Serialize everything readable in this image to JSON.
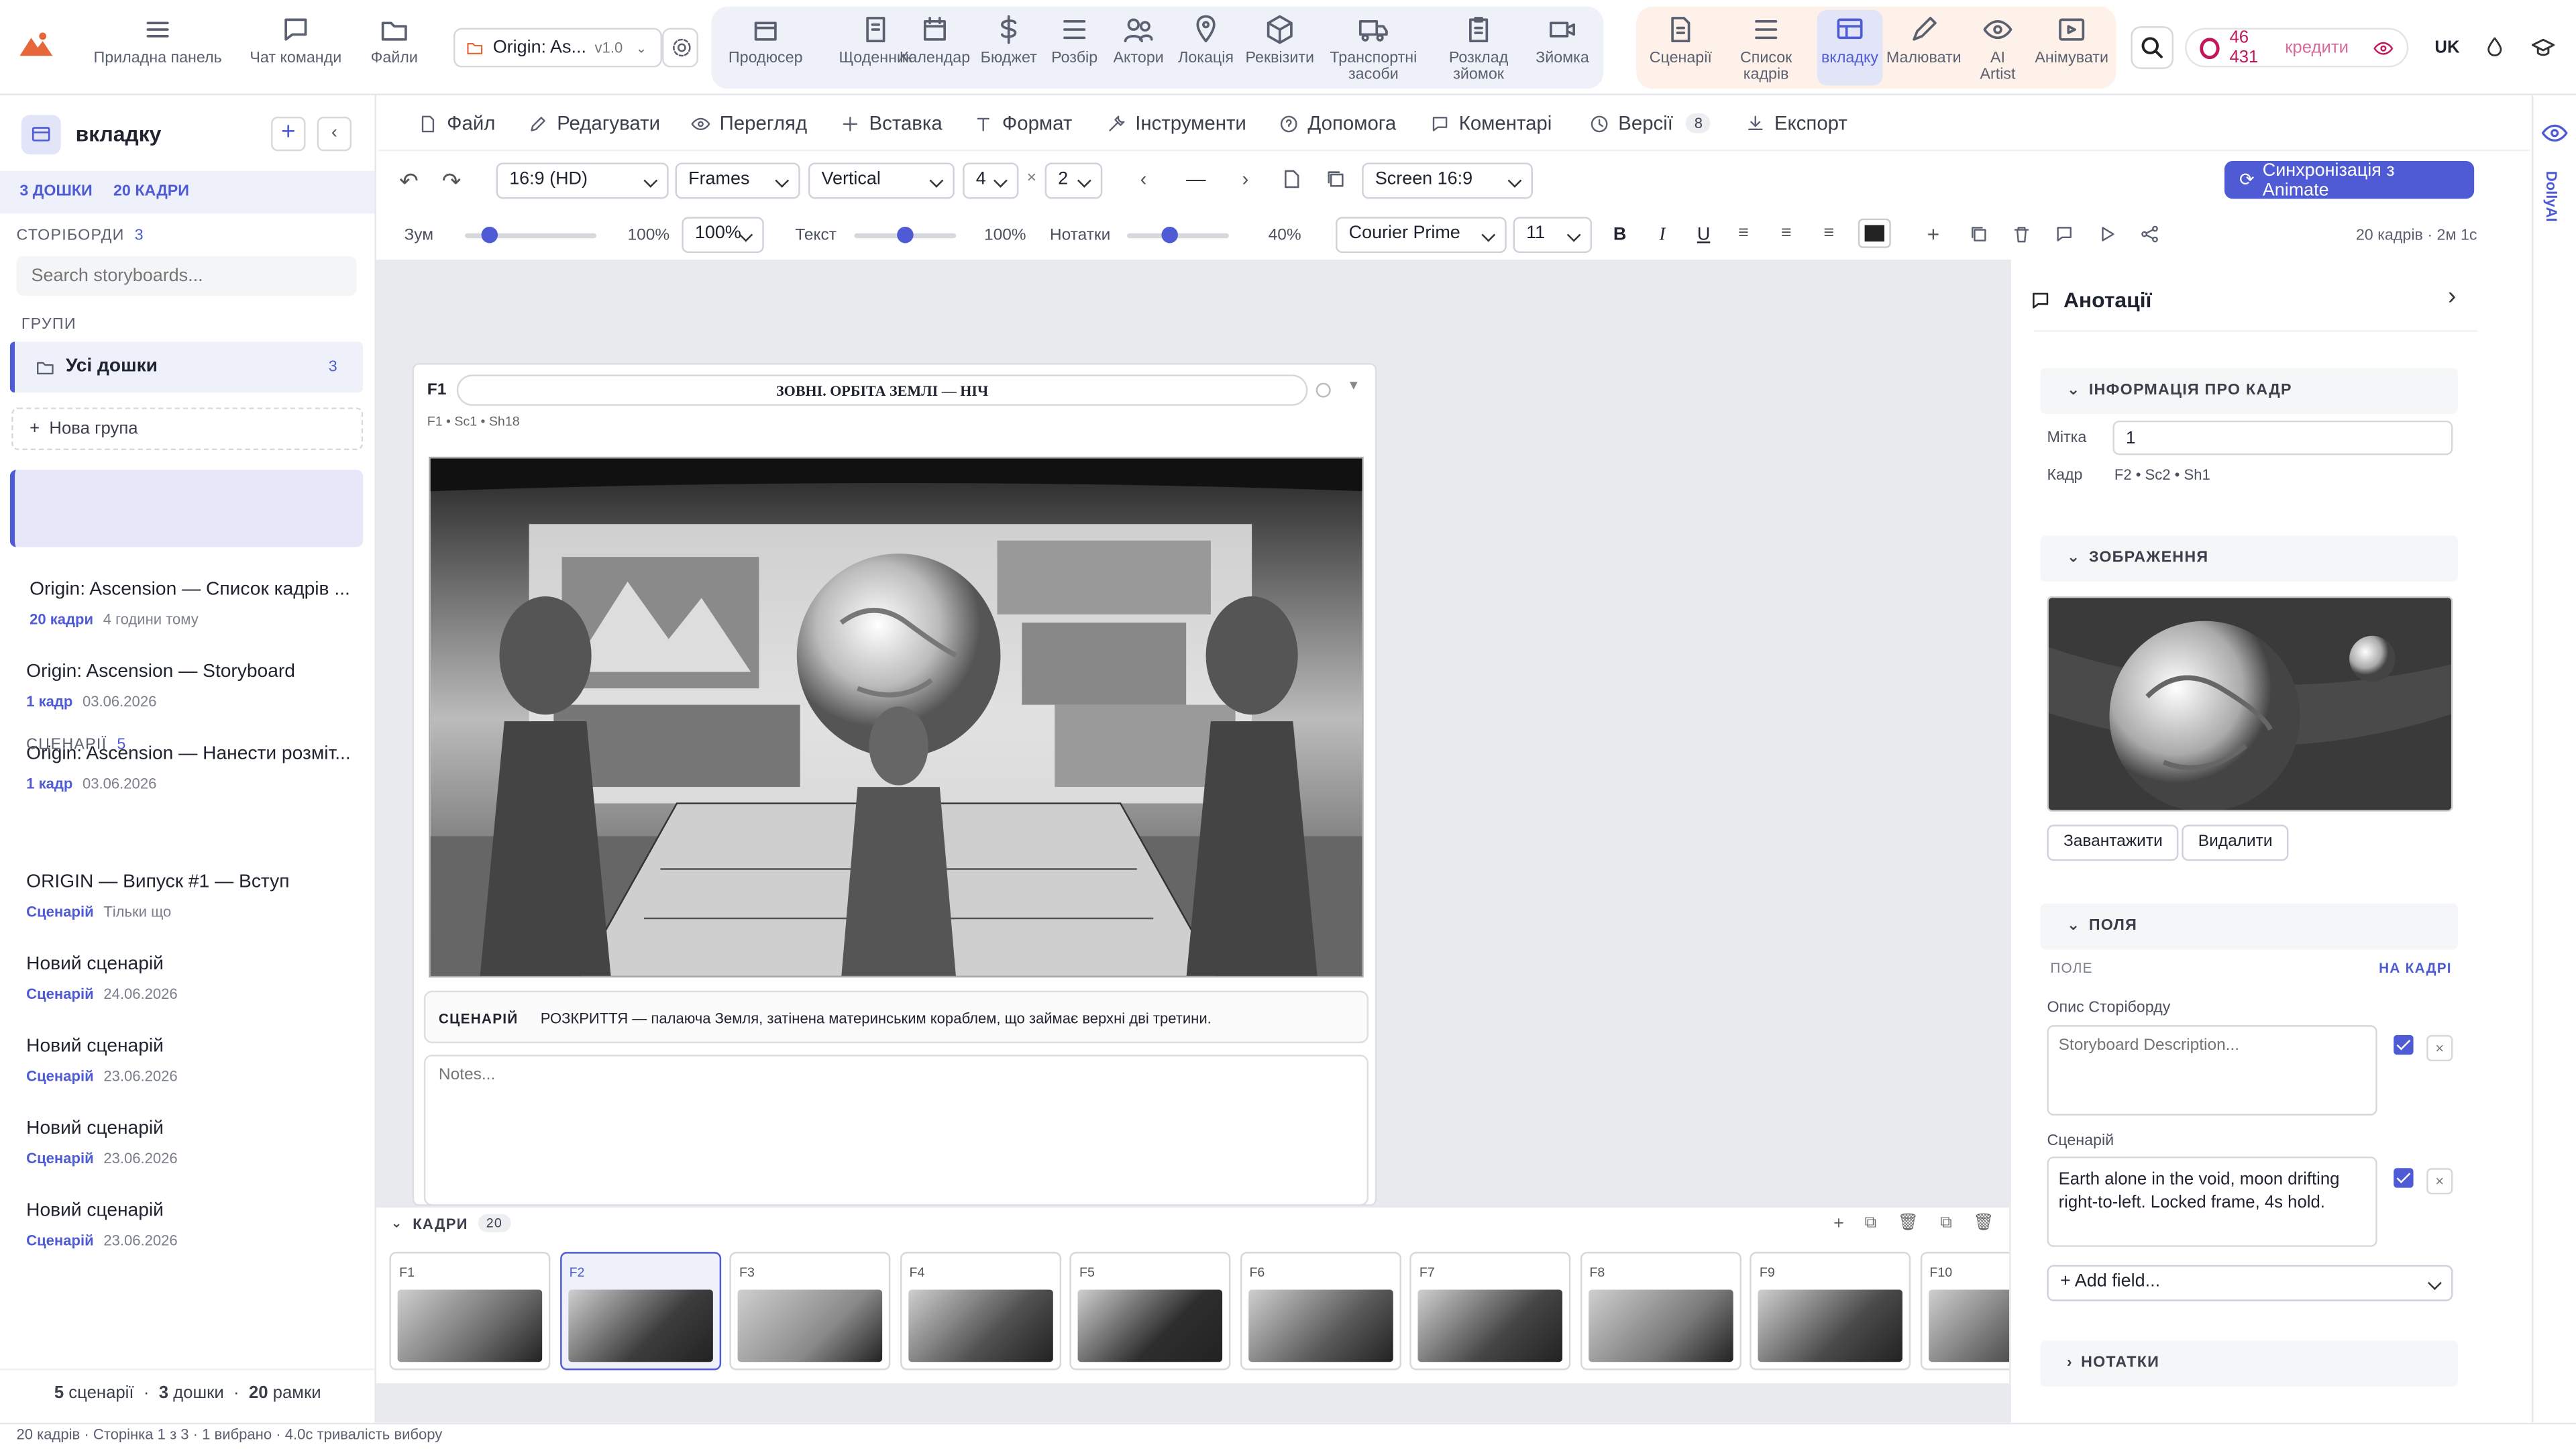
{
  "app": {
    "brand": "logo",
    "title": "вкладку"
  },
  "nav_left": [
    {
      "label": "Приладна панель",
      "icon": "dashboard-icon"
    },
    {
      "label": "Чат команди",
      "icon": "chat-icon"
    },
    {
      "label": "Файли",
      "icon": "folder-icon"
    }
  ],
  "project": {
    "name": "Origin: As...",
    "version": "v1.0"
  },
  "nav_mid": [
    {
      "label": "Продюсер",
      "icon": "producer-icon"
    },
    {
      "label": "Щоденник",
      "icon": "journal-icon"
    },
    {
      "label": "Календар",
      "icon": "calendar-icon"
    },
    {
      "label": "Бюджет",
      "icon": "dollar-icon"
    },
    {
      "label": "Розбір",
      "icon": "breakdown-icon"
    },
    {
      "label": "Актори",
      "icon": "actors-icon"
    },
    {
      "label": "Локація",
      "icon": "location-icon"
    },
    {
      "label": "Реквізити",
      "icon": "props-icon"
    },
    {
      "label": "Транспортні засоби",
      "icon": "vehicle-icon"
    },
    {
      "label": "Розклад зйомок",
      "icon": "schedule-icon"
    },
    {
      "label": "Зйомка",
      "icon": "camera-icon"
    }
  ],
  "nav_right": [
    {
      "label": "Сценарії",
      "icon": "script-icon"
    },
    {
      "label": "Список кадрів",
      "icon": "shotlist-icon"
    },
    {
      "label": "вкладку",
      "icon": "storyboard-icon"
    },
    {
      "label": "Малювати",
      "icon": "pencil-icon"
    },
    {
      "label": "AI Artist",
      "icon": "eye-icon"
    },
    {
      "label": "Анімувати",
      "icon": "animate-icon"
    }
  ],
  "credits": {
    "amount": "46 431",
    "label": "кредити"
  },
  "lang": "UK",
  "menus": [
    {
      "label": "Файл",
      "icon": "file-icon"
    },
    {
      "label": "Редагувати",
      "icon": "edit-icon"
    },
    {
      "label": "Перегляд",
      "icon": "eye-icon"
    },
    {
      "label": "Вставка",
      "icon": "plus-icon"
    },
    {
      "label": "Формат",
      "icon": "text-icon"
    },
    {
      "label": "Інструменти",
      "icon": "tools-icon"
    },
    {
      "label": "Допомога",
      "icon": "help-icon"
    },
    {
      "label": "Коментарі",
      "icon": "comment-icon"
    },
    {
      "label": "Версії",
      "icon": "history-icon",
      "badge": "8"
    },
    {
      "label": "Експорт",
      "icon": "export-icon"
    }
  ],
  "toolbar": {
    "aspect": "16:9 (HD)",
    "frames": "Frames",
    "layout": "Vertical",
    "cols": "4",
    "rows": "2",
    "screen": "Screen 16:9",
    "sync": "Синхронізація з Animate"
  },
  "toolbar3": {
    "zoom_label": "Зум",
    "zoom_value": "100%",
    "zoom_select": "100%",
    "text_label": "Текст",
    "text_value": "100%",
    "notes_label": "Нотатки",
    "notes_value": "40%",
    "font": "Courier Prime",
    "size": "11",
    "bold": "B",
    "italic": "I",
    "underline": "U",
    "summary": "20 кадрів · 2м 1с"
  },
  "sidebar": {
    "title": "вкладку",
    "boards_tab": "3 ДОШКИ",
    "frames_tab": "20 КАДРИ",
    "storyboards_label": "СТОРІБОРДИ",
    "storyboards_count": "3",
    "search_placeholder": "Search storyboards...",
    "groups_label": "ГРУПИ",
    "all_boards": "Усі дошки",
    "all_count": "3",
    "new_group": "Нова група",
    "boards": [
      {
        "title": "Origin: Ascension — Список кадрів ...",
        "count": "20 кадри",
        "meta": "4 години тому"
      },
      {
        "title": "Origin: Ascension — Storyboard",
        "count": "1 кадр",
        "meta": "03.06.2026"
      },
      {
        "title": "Origin: Ascension — Нанести розміт...",
        "count": "1 кадр",
        "meta": "03.06.2026"
      }
    ],
    "scripts_label": "СЦЕНАРІЇ",
    "scripts_count": "5",
    "scripts": [
      {
        "title": "ORIGIN — Випуск #1 — Вступ",
        "tag": "Сценарій",
        "meta": "Тільки що"
      },
      {
        "title": "Новий сценарій",
        "tag": "Сценарій",
        "meta": "24.06.2026"
      },
      {
        "title": "Новий сценарій",
        "tag": "Сценарій",
        "meta": "23.06.2026"
      },
      {
        "title": "Новий сценарій",
        "tag": "Сценарій",
        "meta": "23.06.2026"
      },
      {
        "title": "Новий сценарій",
        "tag": "Сценарій",
        "meta": "23.06.2026"
      }
    ],
    "footer": {
      "a": "5",
      "a_label": "сценарії",
      "b": "3",
      "b_label": "дошки",
      "c": "20",
      "c_label": "рамки"
    }
  },
  "frame": {
    "id": "F1",
    "heading": "ЗОВНІ. ОРБІТА ЗЕМЛІ — НІЧ",
    "meta": "F1 • Sc1 • Sh18",
    "script_label": "СЦЕНАРІЙ",
    "script_text": "РОЗКРИТТЯ — палаюча Земля, затінена материнським кораблем, що займає верхні дві третини.",
    "notes_placeholder": "Notes..."
  },
  "strip": {
    "label": "КАДРИ",
    "count": "20",
    "frames": [
      "F1",
      "F2",
      "F3",
      "F4",
      "F5",
      "F6",
      "F7",
      "F8",
      "F9",
      "F10"
    ]
  },
  "panel": {
    "title": "Анотації",
    "info_section": "ІНФОРМАЦІЯ ПРО КАДР",
    "mark_label": "Мітка",
    "mark_value": "1",
    "shot_label": "Кадр",
    "shot_value": "F2 • Sc2 • Sh1",
    "image_section": "ЗОБРАЖЕННЯ",
    "upload": "Завантажити",
    "delete": "Видалити",
    "fields_section": "ПОЛЯ",
    "field_col": "ПОЛЕ",
    "on_frame_col": "НА КАДРІ",
    "desc_label": "Опис Сторіборду",
    "desc_placeholder": "Storyboard Description...",
    "scen_label": "Сценарій",
    "scen_value": "Earth alone in the void, moon drifting right-to-left. Locked frame, 4s hold.",
    "add_field": "+ Add field...",
    "notes_section": "НОТАТКИ"
  },
  "side_tab": "DollyAI",
  "status": "20 кадрів · Сторінка 1 з 3 · 1 вибрано · 4.0с тривалість вибору"
}
